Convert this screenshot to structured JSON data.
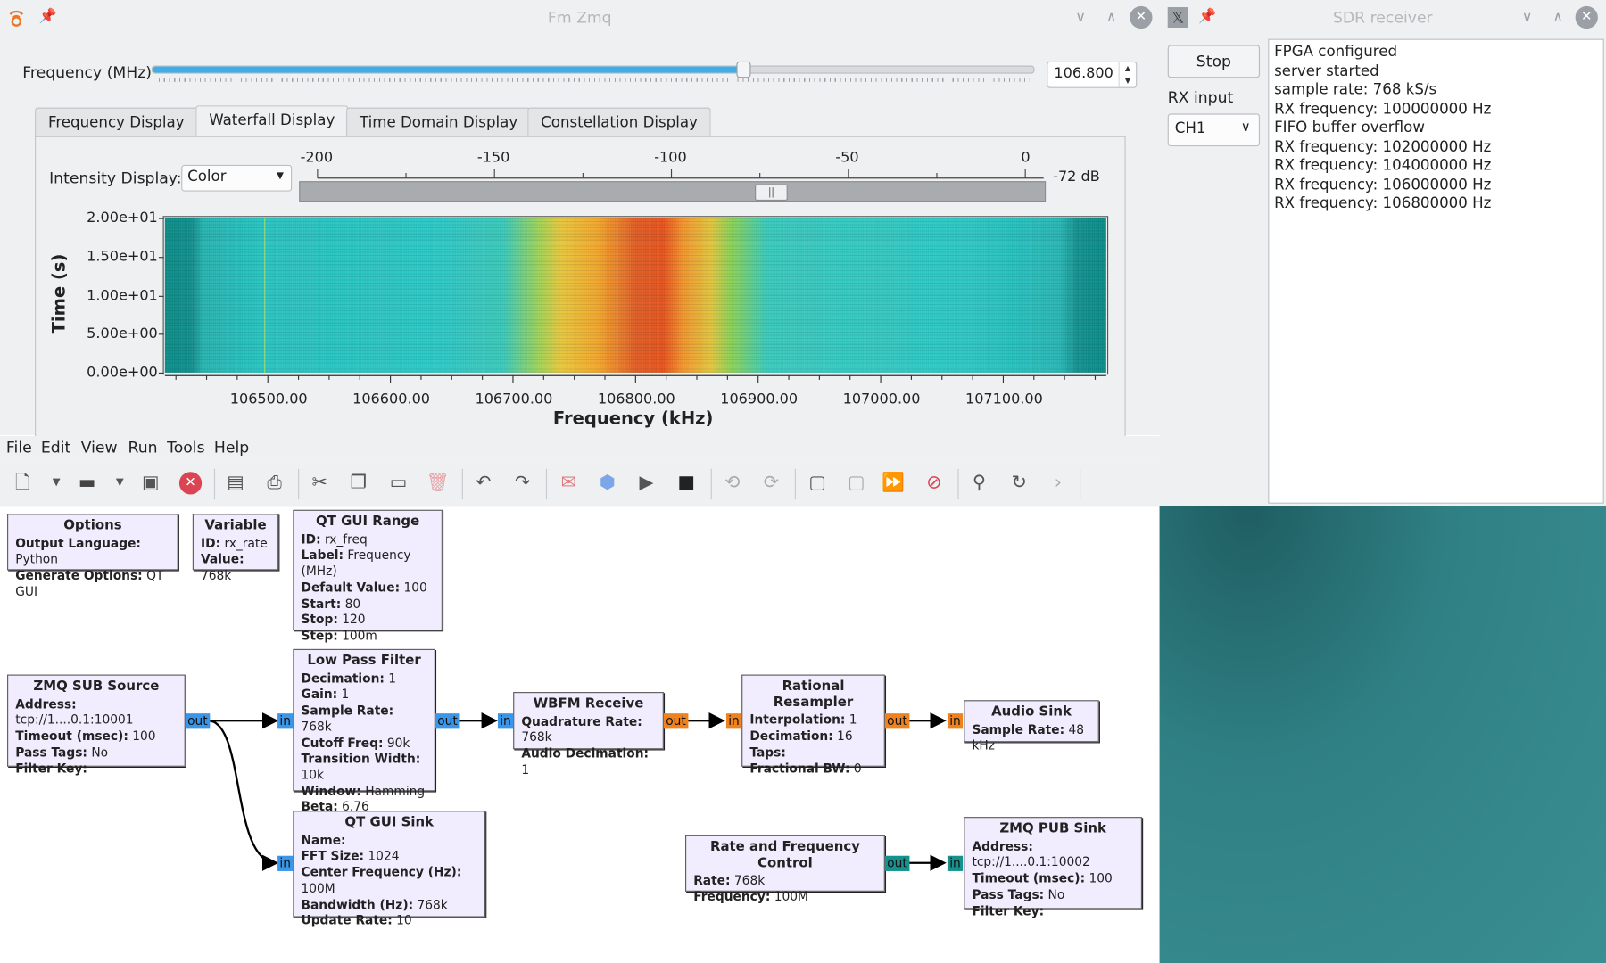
{
  "fm_window": {
    "title": "Fm Zmq",
    "frequency_label": "Frequency (MHz)",
    "frequency_value": "106.800",
    "frequency_fraction": 0.67,
    "tabs": [
      {
        "label": "Frequency Display"
      },
      {
        "label": "Waterfall Display"
      },
      {
        "label": "Time Domain Display"
      },
      {
        "label": "Constellation Display"
      }
    ],
    "active_tab": "Waterfall Display",
    "intensity_label": "Intensity Display:",
    "intensity_value": "Color",
    "intensity_ticks": [
      "-200",
      "-150",
      "-100",
      "-50",
      "0"
    ],
    "intensity_level": "-72 dB",
    "intensity_level_value": -72
  },
  "chart_data": {
    "type": "heatmap",
    "xlabel": "Frequency (kHz)",
    "ylabel": "Time (s)",
    "x_ticks": [
      "106500.00",
      "106600.00",
      "106700.00",
      "106800.00",
      "106900.00",
      "107000.00",
      "107100.00"
    ],
    "y_ticks": [
      "0.00e+00",
      "5.00e+00",
      "1.00e+01",
      "1.50e+01",
      "2.00e+01"
    ],
    "xlim": [
      106416,
      107184
    ],
    "ylim": [
      0,
      20
    ],
    "peak_center_khz": 106800,
    "colormap": [
      "#0c8a86",
      "#2cc7c4",
      "#e8c63b",
      "#e25a20"
    ]
  },
  "menubar": {
    "items": [
      "File",
      "Edit",
      "View",
      "Run",
      "Tools",
      "Help"
    ]
  },
  "toolbar": {
    "icons": [
      "new-icon",
      "open-icon",
      "save-icon",
      "close-icon",
      "print-preview-icon",
      "print-icon",
      "cut-icon",
      "copy-icon",
      "paste-icon",
      "delete-icon",
      "undo-icon",
      "redo-icon",
      "errors-icon",
      "generate-icon",
      "run-icon",
      "stop-icon",
      "rotate-ccw-icon",
      "rotate-cw-icon",
      "enable-icon",
      "disable-icon",
      "bypass-icon",
      "kill-icon",
      "find-icon",
      "reload-icon",
      "more-icon"
    ]
  },
  "flowgraph": {
    "options": {
      "title": "Options",
      "rows": [
        [
          "Output Language:",
          "Python"
        ],
        [
          "Generate Options:",
          "QT GUI"
        ]
      ]
    },
    "variable": {
      "title": "Variable",
      "rows": [
        [
          "ID:",
          "rx_rate"
        ],
        [
          "Value:",
          "768k"
        ]
      ]
    },
    "qt_gui_range": {
      "title": "QT GUI Range",
      "rows": [
        [
          "ID:",
          "rx_freq"
        ],
        [
          "Label:",
          "Frequency (MHz)"
        ],
        [
          "Default Value:",
          "100"
        ],
        [
          "Start:",
          "80"
        ],
        [
          "Stop:",
          "120"
        ],
        [
          "Step:",
          "100m"
        ]
      ]
    },
    "zmq_sub_source": {
      "title": "ZMQ SUB Source",
      "rows": [
        [
          "Address:",
          "tcp://1....0.1:10001"
        ],
        [
          "Timeout (msec):",
          "100"
        ],
        [
          "Pass Tags:",
          "No"
        ],
        [
          "Filter Key:",
          ""
        ]
      ]
    },
    "low_pass_filter": {
      "title": "Low Pass Filter",
      "rows": [
        [
          "Decimation:",
          "1"
        ],
        [
          "Gain:",
          "1"
        ],
        [
          "Sample Rate:",
          "768k"
        ],
        [
          "Cutoff Freq:",
          "90k"
        ],
        [
          "Transition Width:",
          "10k"
        ],
        [
          "Window:",
          "Hamming"
        ],
        [
          "Beta:",
          "6.76"
        ]
      ]
    },
    "wbfm_receive": {
      "title": "WBFM Receive",
      "rows": [
        [
          "Quadrature Rate:",
          "768k"
        ],
        [
          "Audio Decimation:",
          "1"
        ]
      ]
    },
    "rational_resampler": {
      "title": "Rational Resampler",
      "rows": [
        [
          "Interpolation:",
          "1"
        ],
        [
          "Decimation:",
          "16"
        ],
        [
          "Taps:",
          ""
        ],
        [
          "Fractional BW:",
          "0"
        ]
      ]
    },
    "audio_sink": {
      "title": "Audio Sink",
      "rows": [
        [
          "Sample Rate:",
          "48 kHz"
        ]
      ]
    },
    "qt_gui_sink": {
      "title": "QT GUI Sink",
      "rows": [
        [
          "Name:",
          ""
        ],
        [
          "FFT Size:",
          "1024"
        ],
        [
          "Center Frequency (Hz):",
          "100M"
        ],
        [
          "Bandwidth (Hz):",
          "768k"
        ],
        [
          "Update Rate:",
          "10"
        ]
      ]
    },
    "rate_freq_control": {
      "title": "Rate and Frequency Control",
      "rows": [
        [
          "Rate:",
          "768k"
        ],
        [
          "Frequency:",
          "100M"
        ]
      ]
    },
    "zmq_pub_sink": {
      "title": "ZMQ PUB Sink",
      "rows": [
        [
          "Address:",
          "tcp://1....0.1:10002"
        ],
        [
          "Timeout (msec):",
          "100"
        ],
        [
          "Pass Tags:",
          "No"
        ],
        [
          "Filter Key:",
          ""
        ]
      ]
    },
    "port_in": "in",
    "port_out": "out"
  },
  "sdr_window": {
    "title": "SDR receiver",
    "stop_label": "Stop",
    "rx_input_label": "RX input",
    "rx_input_value": "CH1",
    "log": [
      "FPGA configured",
      "server started",
      "sample rate: 768 kS/s",
      "RX frequency: 100000000 Hz",
      "FIFO buffer overflow",
      "RX frequency: 102000000 Hz",
      "RX frequency: 104000000 Hz",
      "RX frequency: 106000000 Hz",
      "RX frequency: 106800000 Hz"
    ]
  },
  "colors": {
    "accent": "#3daee9",
    "port_blue": "#3a96e8",
    "port_orange": "#f0821e",
    "port_teal": "#16928e",
    "block_fill": "#f1ecfe"
  }
}
